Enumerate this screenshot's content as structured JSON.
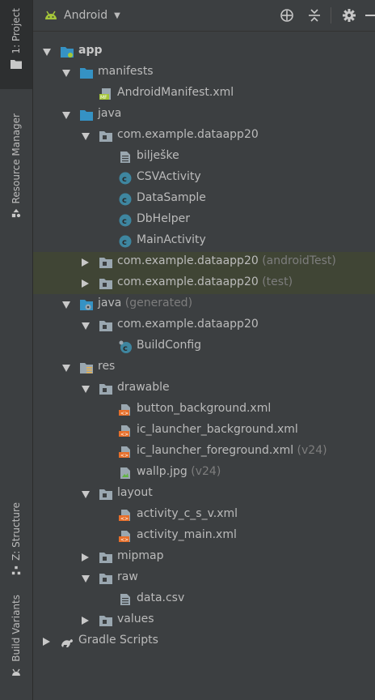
{
  "side_panel": {
    "tabs": [
      {
        "label": "1: Project"
      },
      {
        "label": "Resource Manager"
      },
      {
        "label": "Z: Structure"
      },
      {
        "label": "Build Variants"
      }
    ]
  },
  "toolbar": {
    "view_label": "Android"
  },
  "tree": [
    {
      "label": "app",
      "suffix": "",
      "level": 0,
      "expander": "down",
      "icon": "module-folder-icon",
      "bold": true
    },
    {
      "label": "manifests",
      "suffix": "",
      "level": 1,
      "expander": "down",
      "icon": "folder-icon"
    },
    {
      "label": "AndroidManifest.xml",
      "suffix": "",
      "level": 2,
      "expander": "",
      "icon": "manifest-file-icon"
    },
    {
      "label": "java",
      "suffix": "",
      "level": 1,
      "expander": "down",
      "icon": "folder-icon"
    },
    {
      "label": "com.example.dataapp20",
      "suffix": "",
      "level": 2,
      "expander": "down",
      "icon": "package-icon"
    },
    {
      "label": "bilješke",
      "suffix": "",
      "level": 3,
      "expander": "",
      "icon": "text-file-icon"
    },
    {
      "label": "CSVActivity",
      "suffix": "",
      "level": 3,
      "expander": "",
      "icon": "class-icon"
    },
    {
      "label": "DataSample",
      "suffix": "",
      "level": 3,
      "expander": "",
      "icon": "class-icon"
    },
    {
      "label": "DbHelper",
      "suffix": "",
      "level": 3,
      "expander": "",
      "icon": "class-icon"
    },
    {
      "label": "MainActivity",
      "suffix": "",
      "level": 3,
      "expander": "",
      "icon": "class-icon"
    },
    {
      "label": "com.example.dataapp20",
      "suffix": " (androidTest)",
      "level": 2,
      "expander": "right",
      "icon": "package-icon",
      "highlight": true
    },
    {
      "label": "com.example.dataapp20",
      "suffix": " (test)",
      "level": 2,
      "expander": "right",
      "icon": "package-icon",
      "highlight": true
    },
    {
      "label": "java",
      "suffix": " (generated)",
      "level": 1,
      "expander": "down",
      "icon": "generated-folder-icon"
    },
    {
      "label": "com.example.dataapp20",
      "suffix": "",
      "level": 2,
      "expander": "down",
      "icon": "package-icon"
    },
    {
      "label": "BuildConfig",
      "suffix": "",
      "level": 3,
      "expander": "",
      "icon": "generated-class-icon"
    },
    {
      "label": "res",
      "suffix": "",
      "level": 1,
      "expander": "down",
      "icon": "res-folder-icon"
    },
    {
      "label": "drawable",
      "suffix": "",
      "level": 2,
      "expander": "down",
      "icon": "package-icon"
    },
    {
      "label": "button_background.xml",
      "suffix": "",
      "level": 3,
      "expander": "",
      "icon": "xml-file-icon"
    },
    {
      "label": "ic_launcher_background.xml",
      "suffix": "",
      "level": 3,
      "expander": "",
      "icon": "xml-file-icon"
    },
    {
      "label": "ic_launcher_foreground.xml",
      "suffix": " (v24)",
      "level": 3,
      "expander": "",
      "icon": "xml-file-icon"
    },
    {
      "label": "wallp.jpg",
      "suffix": " (v24)",
      "level": 3,
      "expander": "",
      "icon": "image-file-icon"
    },
    {
      "label": "layout",
      "suffix": "",
      "level": 2,
      "expander": "down",
      "icon": "package-icon"
    },
    {
      "label": "activity_c_s_v.xml",
      "suffix": "",
      "level": 3,
      "expander": "",
      "icon": "xml-file-icon"
    },
    {
      "label": "activity_main.xml",
      "suffix": "",
      "level": 3,
      "expander": "",
      "icon": "xml-file-icon"
    },
    {
      "label": "mipmap",
      "suffix": "",
      "level": 2,
      "expander": "right",
      "icon": "package-icon"
    },
    {
      "label": "raw",
      "suffix": "",
      "level": 2,
      "expander": "down",
      "icon": "package-icon"
    },
    {
      "label": "data.csv",
      "suffix": "",
      "level": 3,
      "expander": "",
      "icon": "text-file-icon"
    },
    {
      "label": "values",
      "suffix": "",
      "level": 2,
      "expander": "right",
      "icon": "package-icon"
    },
    {
      "label": "Gradle Scripts",
      "suffix": "",
      "level": 0,
      "expander": "right",
      "icon": "gradle-icon"
    }
  ],
  "colors": {
    "background": "#3c3f41",
    "highlight_row": "#404535",
    "text": "#bbbbbb",
    "suffix_text": "#7d7d7d",
    "folder_blue": "#3592c4",
    "class_blue": "#3e86a0",
    "xml_orange": "#e76f2b",
    "android_green": "#a4c639"
  }
}
